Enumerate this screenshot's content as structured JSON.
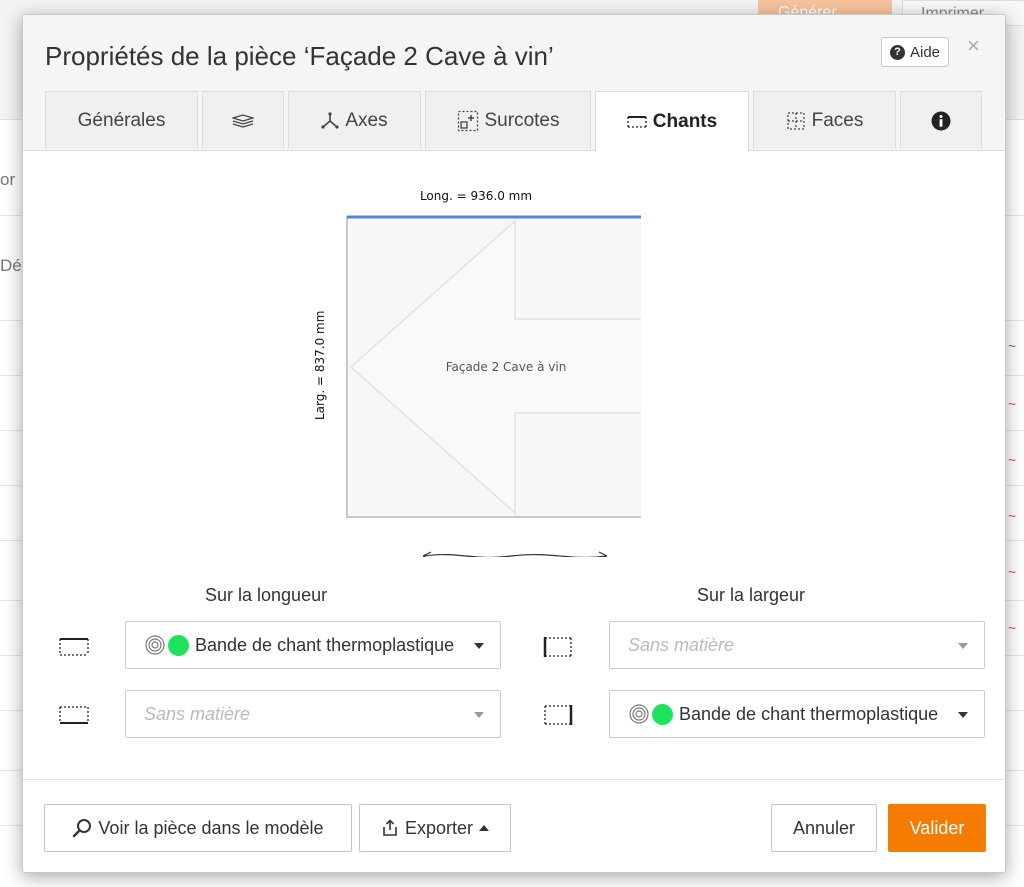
{
  "background": {
    "generate_label": "Générer",
    "print_label": "Imprimer",
    "side_fragment_1": "or",
    "side_fragment_2": "Dé"
  },
  "dialog": {
    "title": "Propriétés de la pièce ‘Façade 2 Cave à vin’",
    "help_label": "Aide",
    "close_glyph": "×"
  },
  "tabs": [
    {
      "label": "Générales",
      "icon": "none"
    },
    {
      "label": "",
      "icon": "layers-icon"
    },
    {
      "label": "Axes",
      "icon": "axes-icon"
    },
    {
      "label": "Surcotes",
      "icon": "surcotes-icon"
    },
    {
      "label": "Chants",
      "icon": "edge-band-icon",
      "active": true
    },
    {
      "label": "Faces",
      "icon": "faces-icon"
    },
    {
      "label": "",
      "icon": "info-icon"
    }
  ],
  "drawing": {
    "length_label": "Long. = 936.0 mm",
    "width_label": "Larg. = 837.0 mm",
    "piece_name": "Façade 2 Cave à vin"
  },
  "edges": {
    "length_header": "Sur la longueur",
    "width_header": "Sur la largeur",
    "length_top": {
      "value": "Bande de chant thermoplastique",
      "placeholder": ""
    },
    "length_bottom": {
      "value": "",
      "placeholder": "Sans matière"
    },
    "width_left": {
      "value": "",
      "placeholder": "Sans matière"
    },
    "width_right": {
      "value": "Bande de chant thermoplastique",
      "placeholder": ""
    },
    "edge_color": "#1ee35a"
  },
  "footer": {
    "view_in_model_label": "Voir la pièce dans le modèle",
    "export_label": "Exporter",
    "cancel_label": "Annuler",
    "validate_label": "Valider"
  },
  "colors": {
    "accent": "#f57c00",
    "edge_highlight": "#5b84d8"
  }
}
